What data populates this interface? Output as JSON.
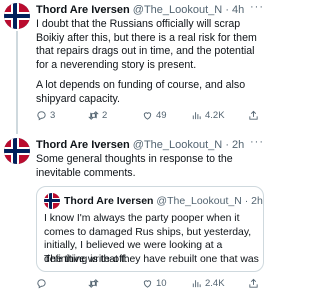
{
  "tweets": [
    {
      "author_name": "Thord Are Iversen",
      "handle": "@The_Lookout_N",
      "time": "4h",
      "paragraphs": [
        "I doubt that the Russians officially will scrap Boikiy after this, but there is a real risk for them that repairs drags out in time, and the potential for a neverending story is present.",
        "A lot depends on funding of course, and also shipyard capacity."
      ],
      "stats": {
        "replies": "3",
        "retweets": "2",
        "likes": "49",
        "views": "4.2K"
      }
    },
    {
      "author_name": "Thord Are Iversen",
      "handle": "@The_Lookout_N",
      "time": "2h",
      "paragraphs": [
        "Some general thoughts in response to the inevitable comments."
      ],
      "quote": {
        "author_name": "Thord Are Iversen",
        "handle": "@The_Lookout_N",
        "time": "2h",
        "paragraphs": [
          "I know I'm always the party pooper when it comes to damaged Rus ships, but yesterday, initially, I believed we were looking at a definitive write-off.",
          "The thing is that they have rebuilt one that was ..."
        ]
      },
      "stats": {
        "replies": "",
        "retweets": "",
        "likes": "10",
        "views": "2.4K"
      }
    }
  ],
  "ui": {
    "separator": "·",
    "more_label": "···"
  },
  "colors": {
    "flag_red": "#ba0c2f",
    "flag_blue": "#00205b",
    "muted": "#536471",
    "border": "#cfd9de"
  }
}
